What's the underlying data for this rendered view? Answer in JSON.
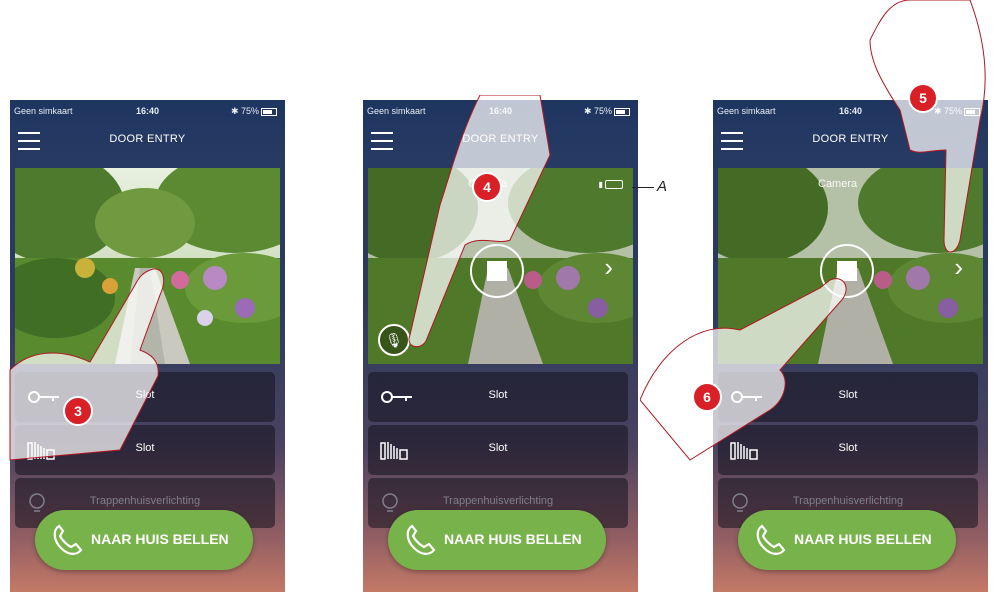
{
  "status": {
    "carrier": "Geen simkaart",
    "time": "16:40",
    "battery": "75%"
  },
  "app": {
    "title": "DOOR ENTRY"
  },
  "camera": {
    "label": "Camera"
  },
  "items": [
    {
      "label": "Slot",
      "icon": "key-icon"
    },
    {
      "label": "Slot",
      "icon": "gate-icon"
    },
    {
      "label": "Trappenhuisverlichting",
      "icon": "lightbulb-icon"
    }
  ],
  "call": {
    "label": "NAAR HUIS BELLEN",
    "icon": "phone-icon"
  },
  "steps": {
    "s3": "3",
    "s4": "4",
    "s5": "5",
    "s6": "6"
  },
  "annotation": {
    "a": "A"
  },
  "colors": {
    "call": "#78b24b",
    "badge": "#d92027",
    "header": "#1e3560"
  }
}
